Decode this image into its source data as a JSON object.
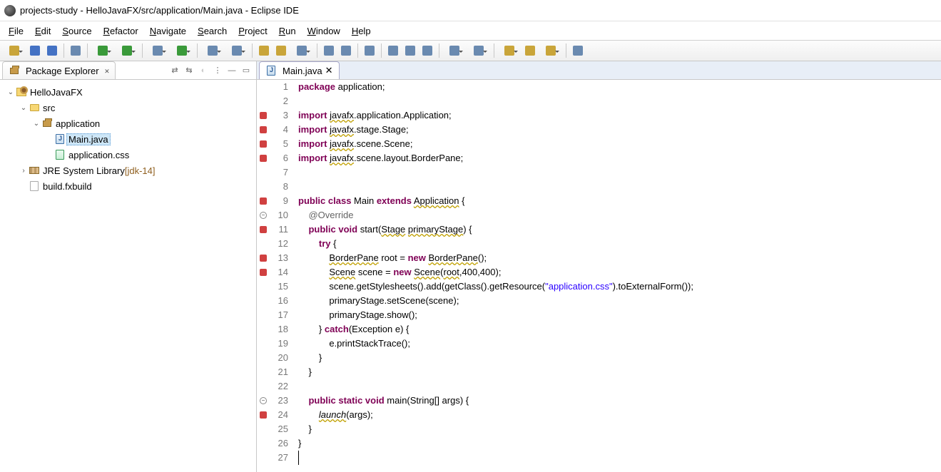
{
  "window": {
    "title": "projects-study - HelloJavaFX/src/application/Main.java - Eclipse IDE"
  },
  "menus": [
    "File",
    "Edit",
    "Source",
    "Refactor",
    "Navigate",
    "Search",
    "Project",
    "Run",
    "Window",
    "Help"
  ],
  "sidebar": {
    "view_title": "Package Explorer",
    "tree": [
      {
        "depth": 0,
        "exp": "open",
        "icon": "proj",
        "label": "HelloJavaFX"
      },
      {
        "depth": 1,
        "exp": "open",
        "icon": "folder",
        "label": "src"
      },
      {
        "depth": 2,
        "exp": "open",
        "icon": "pkg",
        "label": "application"
      },
      {
        "depth": 3,
        "exp": "none",
        "icon": "java",
        "label": "Main.java",
        "selected": true
      },
      {
        "depth": 3,
        "exp": "none",
        "icon": "css",
        "label": "application.css"
      },
      {
        "depth": 1,
        "exp": "closed",
        "icon": "lib",
        "label": "JRE System Library",
        "suffix": "[jdk-14]"
      },
      {
        "depth": 1,
        "exp": "none",
        "icon": "file",
        "label": "build.fxbuild"
      }
    ]
  },
  "editor": {
    "tab_title": "Main.java",
    "lines": [
      {
        "n": 1,
        "gut": "",
        "tokens": [
          [
            "kw",
            "package"
          ],
          [
            "p",
            " application;"
          ]
        ]
      },
      {
        "n": 2,
        "gut": "",
        "tokens": []
      },
      {
        "n": 3,
        "gut": "errfold",
        "tokens": [
          [
            "kw",
            "import"
          ],
          [
            "p",
            " "
          ],
          [
            "sq",
            "javafx"
          ],
          [
            "p",
            ".application.Application;"
          ]
        ]
      },
      {
        "n": 4,
        "gut": "err",
        "tokens": [
          [
            "kw",
            "import"
          ],
          [
            "p",
            " "
          ],
          [
            "sq",
            "javafx"
          ],
          [
            "p",
            ".stage.Stage;"
          ]
        ]
      },
      {
        "n": 5,
        "gut": "err",
        "tokens": [
          [
            "kw",
            "import"
          ],
          [
            "p",
            " "
          ],
          [
            "sq",
            "javafx"
          ],
          [
            "p",
            ".scene.Scene;"
          ]
        ]
      },
      {
        "n": 6,
        "gut": "err",
        "tokens": [
          [
            "kw",
            "import"
          ],
          [
            "p",
            " "
          ],
          [
            "sq",
            "javafx"
          ],
          [
            "p",
            ".scene.layout.BorderPane;"
          ]
        ]
      },
      {
        "n": 7,
        "gut": "",
        "tokens": []
      },
      {
        "n": 8,
        "gut": "",
        "tokens": []
      },
      {
        "n": 9,
        "gut": "err",
        "tokens": [
          [
            "kw",
            "public class"
          ],
          [
            "p",
            " Main "
          ],
          [
            "kw",
            "extends"
          ],
          [
            "p",
            " "
          ],
          [
            "sq",
            "Application"
          ],
          [
            "p",
            " {"
          ]
        ]
      },
      {
        "n": 10,
        "gut": "fold",
        "tokens": [
          [
            "p",
            "    "
          ],
          [
            "ann",
            "@Override"
          ]
        ]
      },
      {
        "n": 11,
        "gut": "err",
        "tokens": [
          [
            "p",
            "    "
          ],
          [
            "kw",
            "public void"
          ],
          [
            "p",
            " start("
          ],
          [
            "sq",
            "Stage"
          ],
          [
            "p",
            " "
          ],
          [
            "sq",
            "primaryStage"
          ],
          [
            "p",
            ") {"
          ]
        ]
      },
      {
        "n": 12,
        "gut": "",
        "tokens": [
          [
            "p",
            "        "
          ],
          [
            "kw",
            "try"
          ],
          [
            "p",
            " {"
          ]
        ]
      },
      {
        "n": 13,
        "gut": "err",
        "tokens": [
          [
            "p",
            "            "
          ],
          [
            "sq",
            "BorderPane"
          ],
          [
            "p",
            " root = "
          ],
          [
            "kw",
            "new"
          ],
          [
            "p",
            " "
          ],
          [
            "sq",
            "BorderPane"
          ],
          [
            "p",
            "();"
          ]
        ]
      },
      {
        "n": 14,
        "gut": "err",
        "tokens": [
          [
            "p",
            "            "
          ],
          [
            "sq",
            "Scene"
          ],
          [
            "p",
            " scene = "
          ],
          [
            "kw",
            "new"
          ],
          [
            "p",
            " "
          ],
          [
            "sq",
            "Scene"
          ],
          [
            "p",
            "("
          ],
          [
            "sq",
            "root"
          ],
          [
            "p",
            ",400,400);"
          ]
        ]
      },
      {
        "n": 15,
        "gut": "",
        "tokens": [
          [
            "p",
            "            scene.getStylesheets().add(getClass().getResource("
          ],
          [
            "str",
            "\"application.css\""
          ],
          [
            "p",
            ").toExternalForm());"
          ]
        ]
      },
      {
        "n": 16,
        "gut": "",
        "tokens": [
          [
            "p",
            "            primaryStage.setScene(scene);"
          ]
        ]
      },
      {
        "n": 17,
        "gut": "",
        "tokens": [
          [
            "p",
            "            primaryStage.show();"
          ]
        ]
      },
      {
        "n": 18,
        "gut": "",
        "tokens": [
          [
            "p",
            "        } "
          ],
          [
            "kw",
            "catch"
          ],
          [
            "p",
            "(Exception e) {"
          ]
        ]
      },
      {
        "n": 19,
        "gut": "",
        "tokens": [
          [
            "p",
            "            e.printStackTrace();"
          ]
        ]
      },
      {
        "n": 20,
        "gut": "",
        "tokens": [
          [
            "p",
            "        }"
          ]
        ]
      },
      {
        "n": 21,
        "gut": "",
        "tokens": [
          [
            "p",
            "    }"
          ]
        ]
      },
      {
        "n": 22,
        "gut": "",
        "tokens": []
      },
      {
        "n": 23,
        "gut": "fold",
        "tokens": [
          [
            "p",
            "    "
          ],
          [
            "kw",
            "public static void"
          ],
          [
            "p",
            " main(String[] args) {"
          ]
        ]
      },
      {
        "n": 24,
        "gut": "err",
        "tokens": [
          [
            "p",
            "        "
          ],
          [
            "sqital",
            "launch"
          ],
          [
            "p",
            "(args);"
          ]
        ]
      },
      {
        "n": 25,
        "gut": "",
        "tokens": [
          [
            "p",
            "    }"
          ]
        ]
      },
      {
        "n": 26,
        "gut": "",
        "tokens": [
          [
            "p",
            "}"
          ]
        ]
      },
      {
        "n": 27,
        "gut": "",
        "tokens": [],
        "cursor": true
      }
    ]
  },
  "toolbar_icons": [
    "new-drop",
    "save",
    "save-all",
    "sep",
    "wand",
    "sep",
    "debug-drop",
    "run-drop",
    "sep",
    "coverage-drop",
    "ext-run-drop",
    "sep",
    "package-drop",
    "update-drop",
    "sep",
    "open-type",
    "open-task",
    "search-drop",
    "sep",
    "toggle-mark",
    "toggle-break",
    "sep",
    "annotate",
    "sep",
    "whitespace",
    "block-sel",
    "paragraph",
    "sep",
    "next-ann-drop",
    "prev-ann-drop",
    "sep",
    "back-drop",
    "fwd",
    "fwd-all-drop",
    "sep",
    "pin"
  ]
}
